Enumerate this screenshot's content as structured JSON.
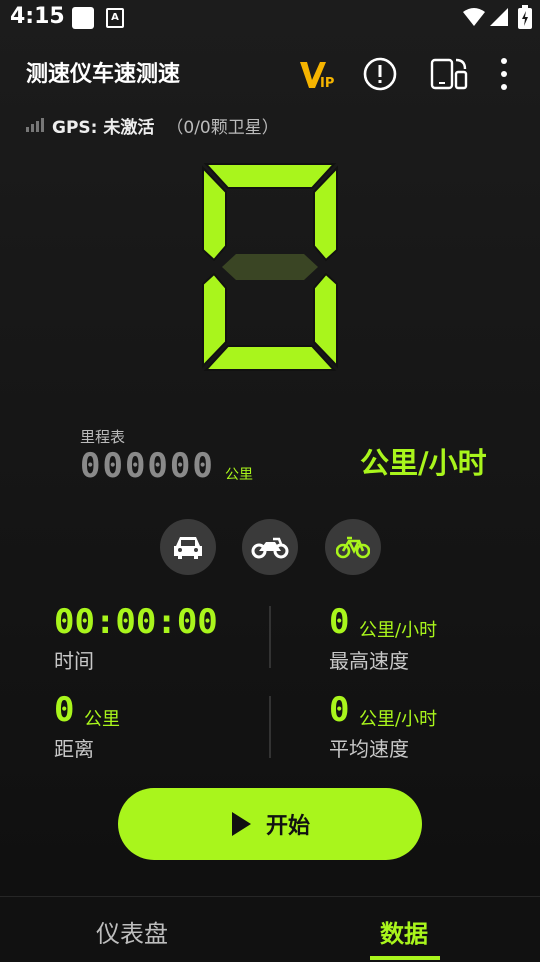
{
  "status_bar": {
    "time": "4:15",
    "icons": [
      "notification-square-icon",
      "app-a-icon",
      "wifi-icon",
      "cell-signal-icon",
      "battery-icon"
    ]
  },
  "app_bar": {
    "title": "测速仪车速测速",
    "icons": [
      "vip-icon",
      "info-icon",
      "rotate-screen-icon",
      "more-icon"
    ],
    "vip_text": "VIP"
  },
  "gps": {
    "label": "GPS: 未激活",
    "satellites": "（0/0颗卫星）"
  },
  "speed": {
    "value": 0,
    "unit": "公里/小时"
  },
  "odometer": {
    "label": "里程表",
    "value": "000000",
    "unit": "公里"
  },
  "vehicles": [
    "car-icon",
    "motorcycle-icon",
    "bicycle-icon"
  ],
  "stats": {
    "time": {
      "value": "00:00:00",
      "label": "时间"
    },
    "max_speed": {
      "value": "0",
      "unit": "公里/小时",
      "label": "最高速度"
    },
    "distance": {
      "value": "0",
      "unit": "公里",
      "label": "距离"
    },
    "avg_speed": {
      "value": "0",
      "unit": "公里/小时",
      "label": "平均速度"
    }
  },
  "start_button": {
    "label": "开始"
  },
  "tabs": [
    {
      "label": "仪表盘",
      "active": false
    },
    {
      "label": "数据",
      "active": true
    }
  ],
  "colors": {
    "accent": "#a9f51c",
    "background": "#161616"
  }
}
